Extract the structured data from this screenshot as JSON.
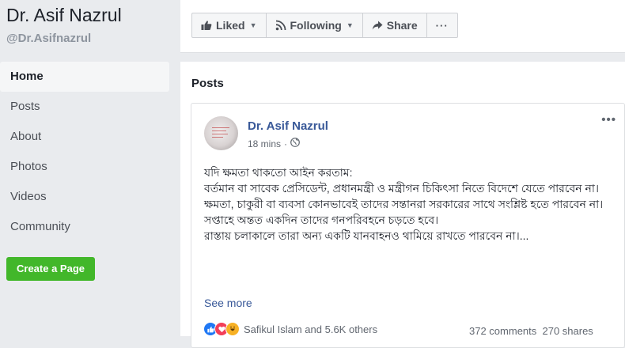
{
  "page": {
    "name": "Dr. Asif Nazrul",
    "handle": "@Dr.Asifnazrul"
  },
  "nav": {
    "items": [
      {
        "label": "Home",
        "active": true
      },
      {
        "label": "Posts"
      },
      {
        "label": "About"
      },
      {
        "label": "Photos"
      },
      {
        "label": "Videos"
      },
      {
        "label": "Community"
      }
    ],
    "create_page_label": "Create a Page"
  },
  "actions": {
    "liked_label": "Liked",
    "following_label": "Following",
    "share_label": "Share",
    "more_label": "···"
  },
  "posts": {
    "section_title": "Posts",
    "post": {
      "author": "Dr. Asif Nazrul",
      "time": "18 mins",
      "audience_icon": "globe-icon",
      "more_label": "•••",
      "lines": [
        "যদি ক্ষমতা থাকতো আইন করতাম:",
        "বর্তমান বা সাবেক প্রেসিডেন্ট, প্রধানমন্ত্রী ও মন্ত্রীগন চিকিৎসা নিতে বিদেশে যেতে পারবেন না।",
        "ক্ষমতা, চাকুরী বা ব্যবসা কোনভাবেই তাদের সন্তানরা সরকারের সাথে সংশ্লিষ্ট হতে পারবেন না।",
        "সপ্তাহে অন্তত একদিন তাদের গনপরিবহনে চড়তে হবে।",
        "রাস্তায় চলাকালে তারা অন্য একটি যানবাহনও থামিয়ে রাখতে পারবেন না।..."
      ],
      "see_more": "See more",
      "reactors": "Safikul Islam and 5.6K others",
      "stats": "372 comments  270 shares",
      "reaction_icons": [
        "like-icon",
        "love-icon",
        "haha-icon"
      ]
    }
  },
  "colors": {
    "background": "#e9ebee",
    "link": "#385898",
    "create_button": "#42b72a"
  }
}
